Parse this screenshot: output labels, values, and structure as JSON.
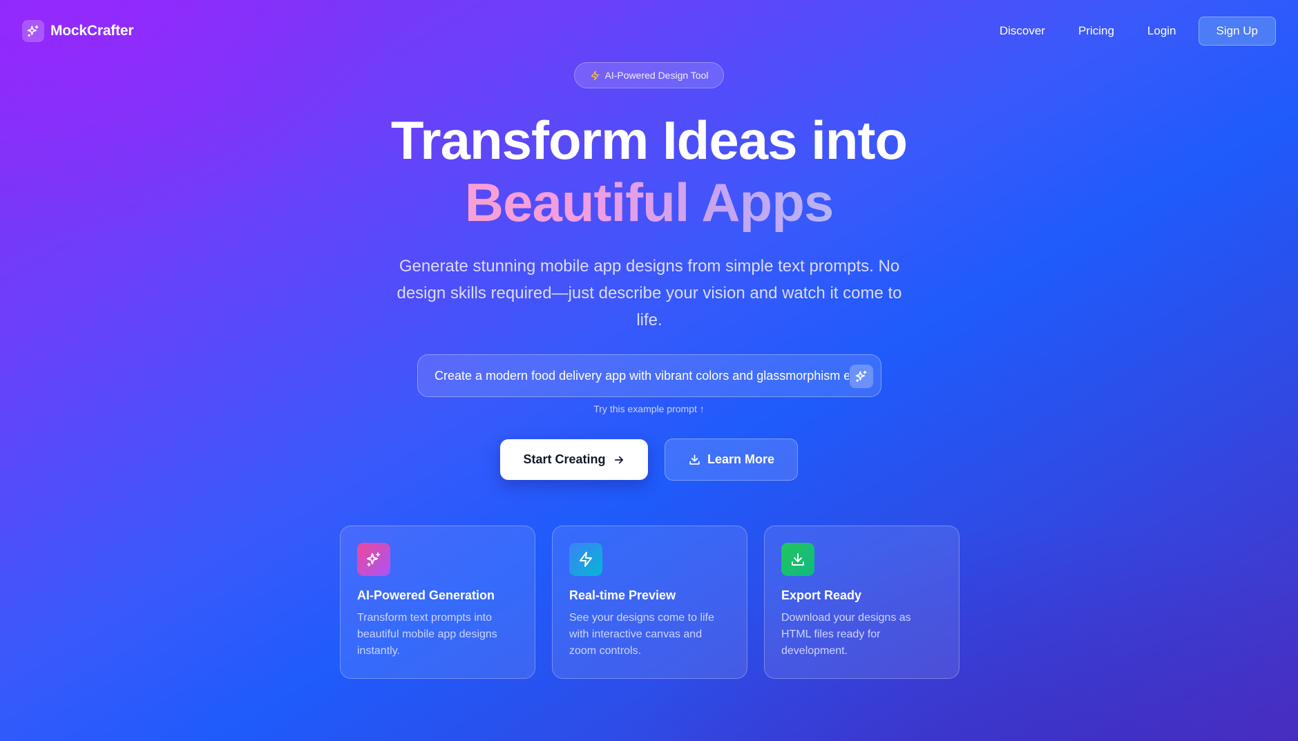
{
  "nav": {
    "brand": "MockCrafter",
    "brand_icon": "sparkles-icon",
    "links": [
      "Discover",
      "Pricing",
      "Login"
    ],
    "signup": "Sign Up"
  },
  "hero": {
    "badge": "AI-Powered Design Tool",
    "badge_icon": "lightning-icon",
    "headline_line1": "Transform Ideas into",
    "headline_line2": "Beautiful Apps",
    "subtitle": "Generate stunning mobile app designs from simple text prompts. No design skills required—just describe your vision and watch it come to life."
  },
  "prompt": {
    "value": "Create a modern food delivery app with vibrant colors and glassmorphism effects",
    "button_icon": "sparkles-icon",
    "hint": "Try this example prompt ↑"
  },
  "cta": {
    "primary": "Start Creating",
    "primary_icon": "arrow-right-icon",
    "secondary": "Learn More",
    "secondary_icon": "download-icon"
  },
  "features": [
    {
      "title": "AI-Powered Generation",
      "desc": "Transform text prompts into beautiful mobile app designs instantly.",
      "icon": "sparkles-icon",
      "colors": [
        "#ec4899",
        "#a855f7"
      ]
    },
    {
      "title": "Real-time Preview",
      "desc": "See your designs come to life with interactive canvas and zoom controls.",
      "icon": "lightning-icon",
      "colors": [
        "#3b82f6",
        "#06b6d4"
      ]
    },
    {
      "title": "Export Ready",
      "desc": "Download your designs as HTML files ready for development.",
      "icon": "download-icon",
      "colors": [
        "#22c55e",
        "#10b981"
      ]
    }
  ]
}
